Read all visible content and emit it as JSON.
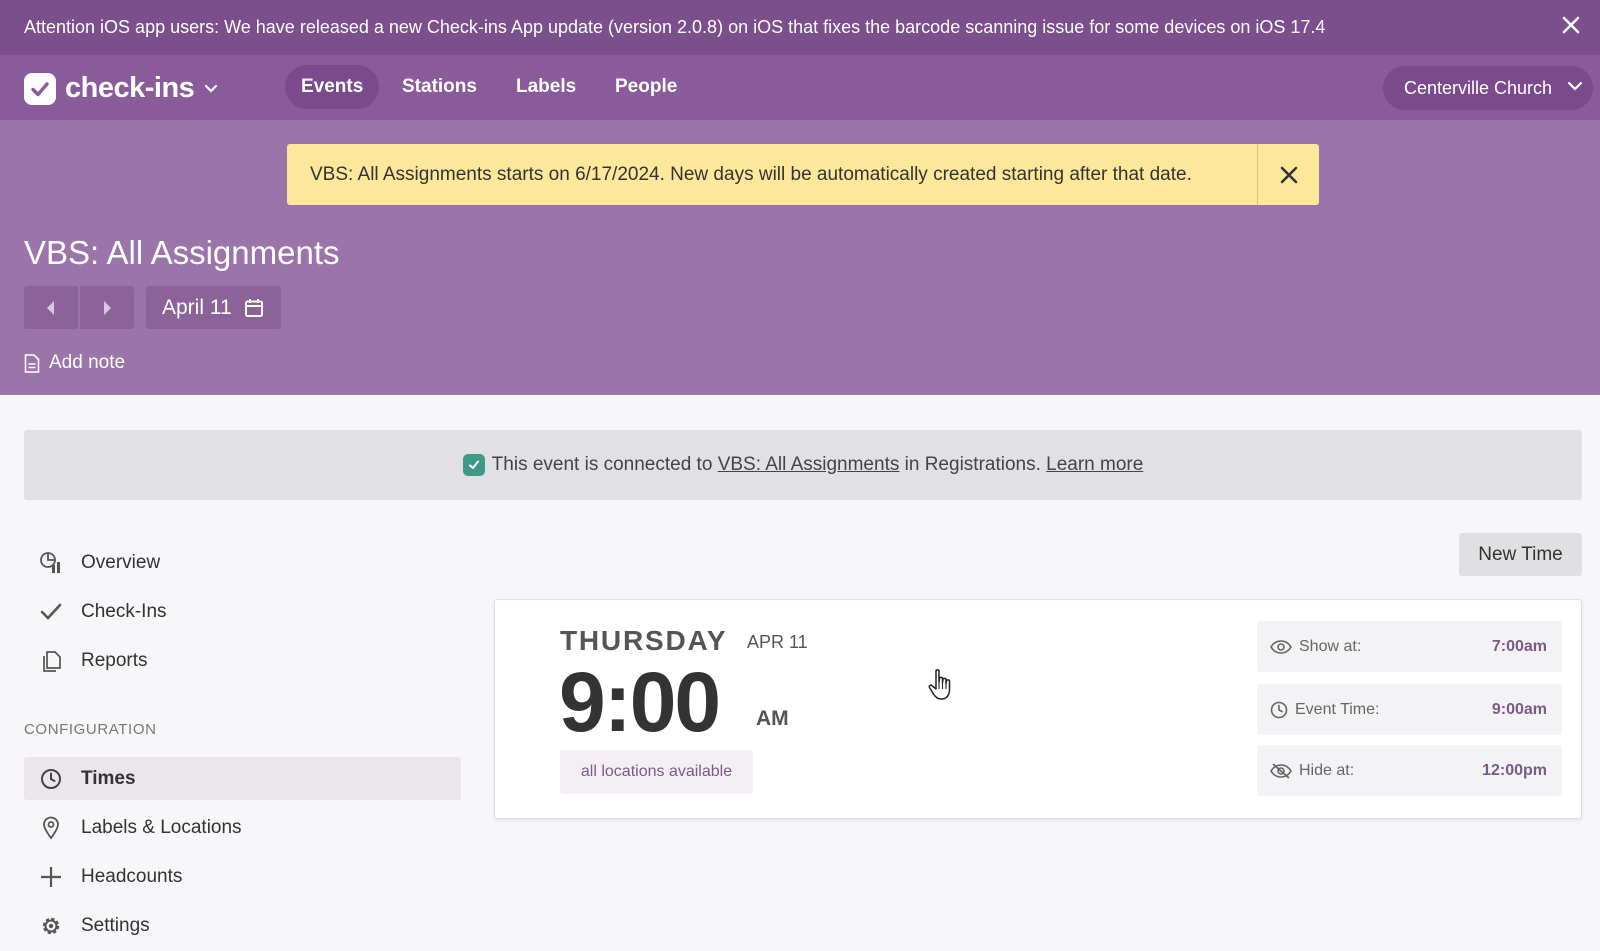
{
  "announcement": {
    "text": "Attention iOS app users: We have released a new Check-ins App update (version 2.0.8) on iOS that fixes the barcode scanning issue for some devices on iOS 17.4"
  },
  "app": {
    "name": "check-ins"
  },
  "nav": {
    "tabs": [
      {
        "label": "Events",
        "active": true
      },
      {
        "label": "Stations"
      },
      {
        "label": "Labels"
      },
      {
        "label": "People"
      }
    ],
    "organization": "Centerville Church"
  },
  "alert": {
    "text": "VBS: All Assignments starts on 6/17/2024. New days will be automatically created starting after that date."
  },
  "event": {
    "title": "VBS: All Assignments",
    "date_label": "April 11",
    "add_note": "Add note"
  },
  "connected": {
    "prefix": "This event is connected to",
    "link": "VBS: All Assignments",
    "middle": "in Registrations.",
    "learn_more": "Learn more"
  },
  "sidebar": {
    "items": [
      {
        "label": "Overview",
        "icon": "overview-icon"
      },
      {
        "label": "Check-Ins",
        "icon": "check-icon"
      },
      {
        "label": "Reports",
        "icon": "reports-icon"
      }
    ],
    "section_label": "CONFIGURATION",
    "config_items": [
      {
        "label": "Times",
        "icon": "clock-icon",
        "active": true
      },
      {
        "label": "Labels & Locations",
        "icon": "location-pin-icon"
      },
      {
        "label": "Headcounts",
        "icon": "plus-icon"
      },
      {
        "label": "Settings",
        "icon": "gear-icon"
      }
    ]
  },
  "times": {
    "new_time_label": "New Time",
    "card": {
      "weekday": "THURSDAY",
      "date": "APR 11",
      "time": "9:00",
      "ampm": "AM",
      "locations": "all locations available",
      "rows": [
        {
          "label": "Show at:",
          "value": "7:00am",
          "icon": "eye-icon"
        },
        {
          "label": "Event Time:",
          "value": "9:00am",
          "icon": "clock-icon"
        },
        {
          "label": "Hide at:",
          "value": "12:00pm",
          "icon": "eye-slash-icon"
        }
      ]
    }
  },
  "colors": {
    "announcement_bg": "#7b4e8c",
    "nav_bg": "#8a5b9b",
    "header_bg": "#9b74a9",
    "alert_bg": "#fde79b",
    "accent": "#7a5a88",
    "registrations_icon": "#3e9a88"
  }
}
